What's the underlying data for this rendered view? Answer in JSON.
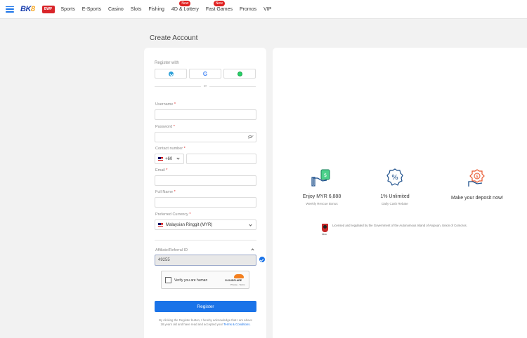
{
  "header": {
    "logo_text": "BK",
    "logo_accent": "8",
    "partner_badge": "BWF",
    "nav": [
      {
        "label": "Sports",
        "badge": ""
      },
      {
        "label": "E-Sports",
        "badge": ""
      },
      {
        "label": "Casino",
        "badge": ""
      },
      {
        "label": "Slots",
        "badge": ""
      },
      {
        "label": "Fishing",
        "badge": ""
      },
      {
        "label": "4D & Lottery",
        "badge": "New"
      },
      {
        "label": "Fast Games",
        "badge": "New"
      },
      {
        "label": "Promos",
        "badge": ""
      },
      {
        "label": "VIP",
        "badge": ""
      }
    ]
  },
  "page_title": "Create Account",
  "form": {
    "register_with": "Register with",
    "social": [
      "telegram-icon",
      "google-icon",
      "whatsapp-icon"
    ],
    "google_glyph": "G",
    "or": "or",
    "username_label": "Username",
    "password_label": "Password",
    "contact_label": "Contact number",
    "country_code": "+60",
    "email_label": "Email",
    "fullname_label": "Full Name",
    "currency_label": "Preferred Currency",
    "currency_value": "Malaysian Ringgit (MYR)",
    "affiliate_label": "Affiliate/Referral ID",
    "affiliate_value": "49255",
    "required_mark": "*",
    "captcha_text": "Verify you are human",
    "captcha_brand": "CLOUDFLARE",
    "captcha_sub": "Privacy · Terms",
    "register_button": "Register",
    "terms_text": "By clicking the Register button, I hereby acknowledge that I am above 18 years old and have read and accepted your",
    "terms_link": "Terms & Conditions."
  },
  "features": [
    {
      "title": "Enjoy MYR 6,888",
      "sub": "Weekly Rescue Bonus",
      "icon": "money-hand-icon"
    },
    {
      "title": "1% Unlimited",
      "sub": "Daily Cash Rebate",
      "icon": "percent-badge-icon"
    },
    {
      "title": "Make your deposit now!",
      "sub": "",
      "icon": "deposit-hand-icon"
    }
  ],
  "license": {
    "logo_text": "MGA",
    "text": "Licensed and regulated by the Government of the Autonomous Island of Anjouan, Union of Comoros."
  },
  "colors": {
    "primary": "#1a73e8",
    "badge": "#e02020",
    "accent": "#e8552a"
  }
}
